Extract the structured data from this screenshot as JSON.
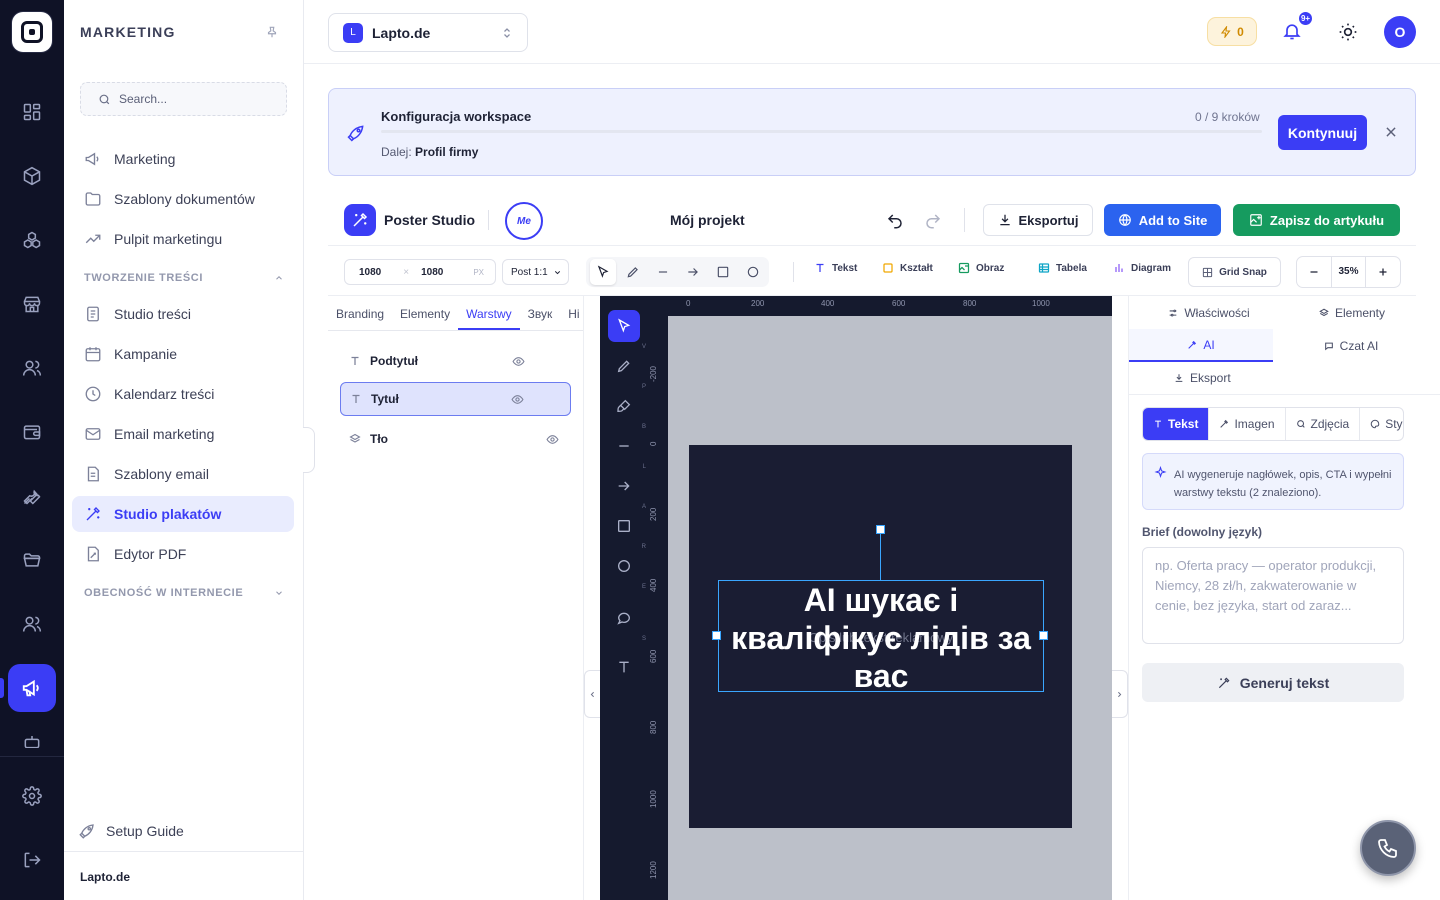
{
  "app": {
    "section_title": "MARKETING",
    "workspace": "Lapto.de",
    "workspace_initial": "L",
    "footer_workspace": "Lapto.de"
  },
  "sidebar": {
    "search_placeholder": "Search...",
    "items": [
      {
        "label": "Marketing",
        "icon": "megaphone-icon"
      },
      {
        "label": "Szablony dokumentów",
        "icon": "folder-icon"
      },
      {
        "label": "Pulpit marketingu",
        "icon": "trend-icon"
      }
    ],
    "section_content": "TWORZENIE TREŚCI",
    "content_items": [
      {
        "label": "Studio treści",
        "icon": "doc-icon"
      },
      {
        "label": "Kampanie",
        "icon": "calendar-icon"
      },
      {
        "label": "Kalendarz treści",
        "icon": "clock-icon"
      },
      {
        "label": "Email marketing",
        "icon": "mail-icon"
      },
      {
        "label": "Szablony email",
        "icon": "file-icon"
      },
      {
        "label": "Studio plakatów",
        "icon": "magic-wand-icon",
        "active": true
      },
      {
        "label": "Edytor PDF",
        "icon": "pdf-icon"
      }
    ],
    "section_web": "OBECNOŚĆ W INTERNECIE",
    "setup_guide": "Setup Guide"
  },
  "header": {
    "credits": "0",
    "notifications_badge": "9+",
    "avatar_initial": "O"
  },
  "banner": {
    "title": "Konfiguracja workspace",
    "steps": "0 / 9 kroków",
    "next_prefix": "Dalej:",
    "next_value": "Profil firmy",
    "continue_label": "Kontynuuj",
    "progress": 0
  },
  "studio": {
    "name": "Poster Studio",
    "me_badge": "Me",
    "project": "Mój projekt",
    "export_label": "Eksportuj",
    "add_to_site_label": "Add to Site",
    "save_label": "Zapisz do artykułu"
  },
  "toolbar": {
    "width": "1080",
    "height": "1080",
    "unit": "PX",
    "times": "×",
    "format": "Post 1:1",
    "insert": [
      "Tekst",
      "Kształt",
      "Obraz",
      "Tabela",
      "Diagram"
    ],
    "grid_snap": "Grid Snap",
    "zoom": "35%"
  },
  "left_panel": {
    "tabs": [
      "Branding",
      "Elementy",
      "Warstwy",
      "Звук",
      "Hi"
    ],
    "active_tab": "Warstwy",
    "layers": [
      {
        "name": "Podtytuł",
        "icon": "text-icon"
      },
      {
        "name": "Tytuł",
        "icon": "text-icon",
        "selected": true
      },
      {
        "name": "Tło",
        "icon": "layers-icon"
      }
    ]
  },
  "canvas": {
    "tool_shortcuts": [
      "V",
      "P",
      "B",
      "L",
      "A",
      "R",
      "E",
      "S"
    ],
    "ruler_x": [
      "0",
      "200",
      "400",
      "600",
      "800",
      "1000"
    ],
    "ruler_y": [
      "-200",
      "0",
      "200",
      "400",
      "600",
      "800",
      "1000",
      "1200"
    ],
    "poster_title": "AI шукає і кваліфікує лідів за вас",
    "poster_subtitle": "Opis lub tekst reklamowy"
  },
  "right_panel": {
    "tabs": [
      "Właściwości",
      "Elementy",
      "AI",
      "Czat AI",
      "Eksport"
    ],
    "active_tab": "AI",
    "modes": [
      "Tekst",
      "Imagen",
      "Zdjęcia",
      "Styl"
    ],
    "active_mode": "Tekst",
    "info": "AI wygeneruje nagłówek, opis, CTA i wypełni warstwy tekstu (2 znaleziono).",
    "brief_label": "Brief (dowolny język)",
    "brief_placeholder": "np. Oferta pracy — operator produkcji, Niemcy, 28 zł/h, zakwaterowanie w cenie, bez języka, start od zaraz...",
    "generate_label": "Generuj tekst"
  },
  "colors": {
    "accent": "#3b3df5",
    "success": "#169b5f",
    "rail": "#0f1226",
    "poster_bg": "#1a1d33"
  }
}
